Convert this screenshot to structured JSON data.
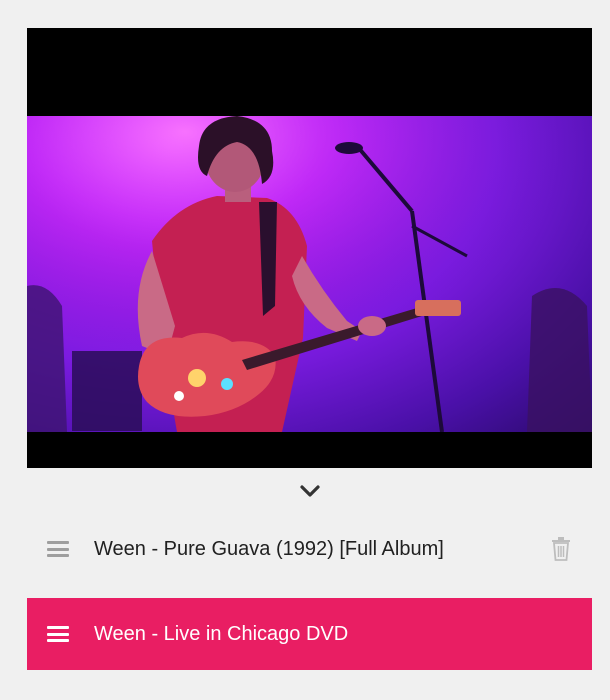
{
  "theme": {
    "accent": "#e91e63",
    "background": "#f0f0f0",
    "player_background": "#000000",
    "icon_gray": "#9e9e9e"
  },
  "player": {
    "content": "video-frame",
    "collapse_icon": "chevron-down-icon"
  },
  "queue": {
    "items": [
      {
        "title": "Ween - Pure Guava (1992) [Full Album]",
        "handle_icon": "drag-handle-icon",
        "delete_icon": "trash-icon",
        "active": false
      },
      {
        "title": "Ween - Live in Chicago DVD",
        "handle_icon": "drag-handle-icon",
        "active": true
      }
    ]
  }
}
